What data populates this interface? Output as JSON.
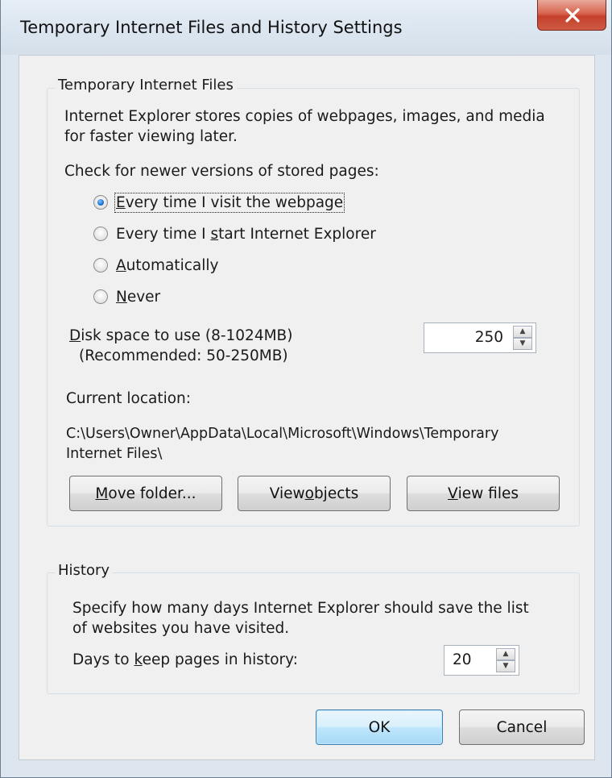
{
  "window": {
    "title": "Temporary Internet Files and History Settings",
    "close_label": "X"
  },
  "temp_files": {
    "legend": "Temporary Internet Files",
    "desc_line1": "Internet Explorer stores copies of webpages, images, and media",
    "desc_line2": "for faster viewing later.",
    "check_label": "Check for newer versions of stored pages:",
    "options": [
      {
        "pre": "",
        "key": "E",
        "post": "very time I visit the webpage",
        "checked": true
      },
      {
        "pre": "Every time I ",
        "key": "s",
        "post": "tart Internet Explorer",
        "checked": false
      },
      {
        "pre": "",
        "key": "A",
        "post": "utomatically",
        "checked": false
      },
      {
        "pre": "",
        "key": "N",
        "post": "ever",
        "checked": false
      }
    ],
    "disk_space": {
      "key": "D",
      "label_rest": "isk space to use (8-1024MB)",
      "recommended": "(Recommended: 50-250MB)",
      "value": "250"
    },
    "current_location_label": "Current location:",
    "path_line1": "C:\\Users\\Owner\\AppData\\Local\\Microsoft\\Windows\\Temporary",
    "path_line2": "Internet Files\\",
    "buttons": {
      "move": {
        "key": "M",
        "rest": "ove folder..."
      },
      "view_objects": {
        "pre": "View ",
        "key": "o",
        "rest": "bjects"
      },
      "view_files": {
        "key": "V",
        "rest": "iew files"
      }
    }
  },
  "history": {
    "legend": "History",
    "desc_line1": "Specify how many days Internet Explorer should save the list",
    "desc_line2": "of websites you have visited.",
    "days": {
      "pre": "Days to ",
      "key": "k",
      "rest": "eep pages in history:",
      "value": "20"
    }
  },
  "dialog_buttons": {
    "ok": "OK",
    "cancel": "Cancel"
  }
}
